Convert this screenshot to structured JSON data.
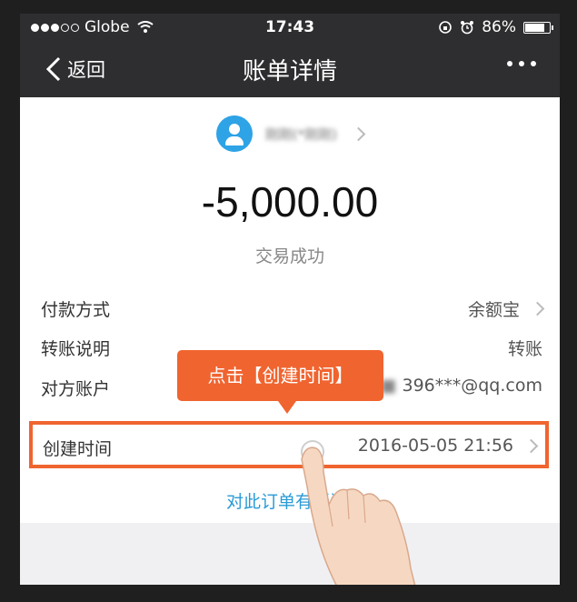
{
  "status_bar": {
    "carrier": "Globe",
    "time": "17:43",
    "battery": "86%",
    "battery_level": 0.86
  },
  "nav": {
    "back_label": "返回",
    "title": "账单详情"
  },
  "contact": {
    "name": "刚刚(*刚刚)"
  },
  "amount": "-5,000.00",
  "status_text": "交易成功",
  "details": [
    {
      "label": "付款方式",
      "value": "余额宝"
    },
    {
      "label": "转账说明",
      "value": "转账"
    },
    {
      "label": "对方账户",
      "value": "396***@qq.com"
    }
  ],
  "created": {
    "label": "创建时间",
    "value": "2016-05-05 21:56"
  },
  "tooltip": "点击【创建时间】",
  "link_text": "对此订单有疑问"
}
